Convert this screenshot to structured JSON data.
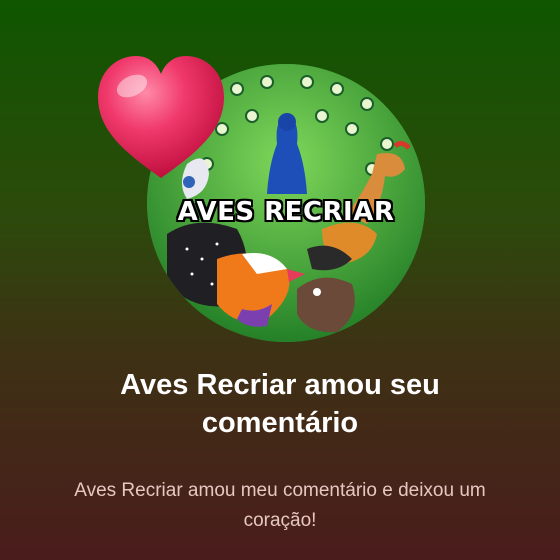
{
  "avatar": {
    "label": "AVES RECRIAR",
    "icon": "birds-collage-avatar"
  },
  "reaction": {
    "icon": "heart-icon",
    "color": "#f0386b"
  },
  "notification": {
    "title": "Aves Recriar amou seu comentário",
    "subtitle": "Aves Recriar amou meu comentário e deixou um coração!"
  },
  "colors": {
    "background_top": "#0f5600",
    "background_bottom": "#4a1c1c",
    "subtitle_text": "#e6c7c2"
  }
}
